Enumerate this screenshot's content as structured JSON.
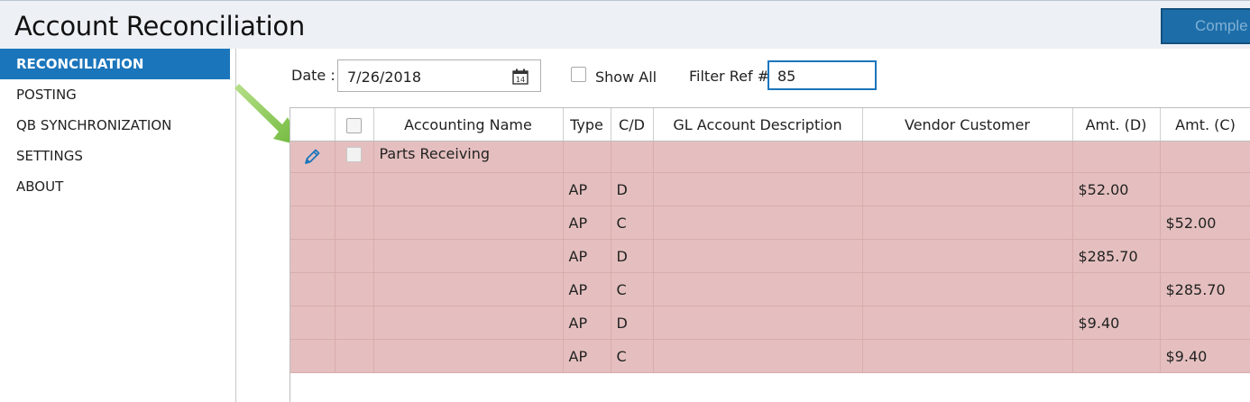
{
  "header": {
    "title": "Account Reconciliation",
    "complete_label": "Comple"
  },
  "sidebar": {
    "items": [
      {
        "label": "RECONCILIATION"
      },
      {
        "label": "POSTING"
      },
      {
        "label": "QB SYNCHRONIZATION"
      },
      {
        "label": "SETTINGS"
      },
      {
        "label": "ABOUT"
      }
    ]
  },
  "filters": {
    "date_label": "Date :",
    "date_value": "7/26/2018",
    "show_all_label": "Show All",
    "filter_ref_label": "Filter Ref #",
    "filter_ref_value": "85"
  },
  "table": {
    "columns": [
      "Accounting Name",
      "Type",
      "C/D",
      "GL Account Description",
      "Vendor Customer",
      "Amt. (D)",
      "Amt. (C)"
    ],
    "group": {
      "accounting_name": "Parts Receiving"
    },
    "rows": [
      {
        "type": "AP",
        "cd": "D",
        "amt_d": "$52.00",
        "amt_c": ""
      },
      {
        "type": "AP",
        "cd": "C",
        "amt_d": "",
        "amt_c": "$52.00"
      },
      {
        "type": "AP",
        "cd": "D",
        "amt_d": "$285.70",
        "amt_c": ""
      },
      {
        "type": "AP",
        "cd": "C",
        "amt_d": "",
        "amt_c": "$285.70"
      },
      {
        "type": "AP",
        "cd": "D",
        "amt_d": "$9.40",
        "amt_c": ""
      },
      {
        "type": "AP",
        "cd": "C",
        "amt_d": "",
        "amt_c": "$9.40"
      }
    ]
  },
  "colors": {
    "accent": "#1b75bb",
    "row_highlight": "#e5bfbf",
    "annotation_arrow": "#7dc242"
  },
  "icons": [
    "calendar-icon",
    "pencil-icon",
    "annotation-arrow"
  ]
}
